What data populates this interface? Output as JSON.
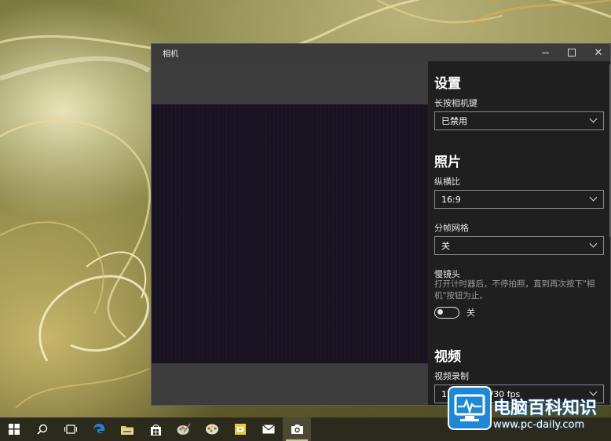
{
  "window": {
    "title": "相机",
    "controls": {
      "minimize": "minimize-icon",
      "maximize": "maximize-icon",
      "close": "✕"
    }
  },
  "settings": {
    "heading": "设置",
    "camera_button": {
      "label": "长按相机键",
      "value": "已禁用"
    },
    "photos": {
      "heading": "照片",
      "aspect_ratio": {
        "label": "纵横比",
        "value": "16:9"
      },
      "framing_grid": {
        "label": "分帧网格",
        "value": "关"
      },
      "time_lapse": {
        "label": "慢镜头",
        "description": "打开计时器后，不停拍照，直到再次按下\"相机\"按钮为止。",
        "toggle_label": "关",
        "on": false
      }
    },
    "video": {
      "heading": "视频",
      "recording": {
        "label": "视频录制",
        "value": "1280x720p/30 fps"
      }
    }
  },
  "taskbar": {
    "items": [
      {
        "name": "start-icon",
        "active": false
      },
      {
        "name": "search-icon",
        "active": false
      },
      {
        "name": "task-view-icon",
        "active": false
      },
      {
        "name": "edge-icon",
        "active": false
      },
      {
        "name": "file-explorer-icon",
        "active": false
      },
      {
        "name": "store-icon",
        "active": false
      },
      {
        "name": "paint-icon",
        "active": false
      },
      {
        "name": "palette-icon",
        "active": false
      },
      {
        "name": "sticky-app-icon",
        "active": false
      },
      {
        "name": "mail-icon",
        "active": false
      },
      {
        "name": "camera-icon",
        "active": true
      }
    ]
  },
  "watermark": {
    "title": "电脑百科知识",
    "url": "www.pc-daily.com"
  },
  "colors": {
    "settings_bg": "#1f1f1f",
    "window_bg": "#3b3b3b",
    "accent_blue": "#1e88d6",
    "taskbar_bg": "#2c2a1c"
  }
}
